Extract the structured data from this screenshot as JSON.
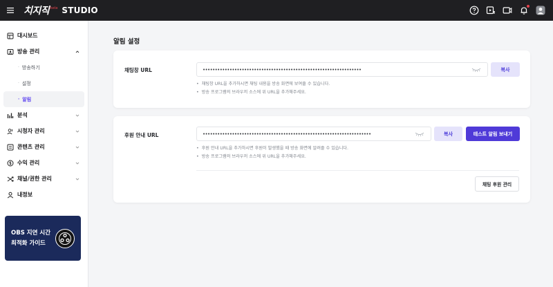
{
  "app": {
    "logo_text": "치지직",
    "beta": "beta",
    "studio": "STUDIO"
  },
  "topbar": {
    "icons": [
      "help-icon",
      "upload-video-icon",
      "camera-icon",
      "notification-bell-icon",
      "user-avatar-icon"
    ],
    "accent_color": "#e5414b"
  },
  "sidebar": {
    "items": [
      {
        "label": "대시보드",
        "icon": "dashboard-icon"
      },
      {
        "label": "방송 관리",
        "icon": "broadcast-icon",
        "expanded": true,
        "children": [
          {
            "label": "방송하기"
          },
          {
            "label": "설정"
          },
          {
            "label": "알림",
            "active": true
          }
        ]
      },
      {
        "label": "분석",
        "icon": "analytics-icon"
      },
      {
        "label": "시청자 관리",
        "icon": "viewers-icon"
      },
      {
        "label": "콘텐츠 관리",
        "icon": "content-icon"
      },
      {
        "label": "수익 관리",
        "icon": "revenue-icon"
      },
      {
        "label": "채널/권한 관리",
        "icon": "channel-permission-icon"
      },
      {
        "label": "내정보",
        "icon": "profile-icon"
      }
    ],
    "banner": {
      "line1": "OBS 지연 시간",
      "line2": "최적화 가이드",
      "icon": "obs-logo-icon"
    }
  },
  "main": {
    "title": "알림 설정",
    "chat": {
      "label": "채팅창 URL",
      "value": "•••••••••••••••••••••••••••••••••••••••••••••••••••••••••••••••••",
      "copy": "복사",
      "help": [
        "채팅창 URL을 추가하시면 채팅 내용을 방송 화면에 보여줄 수 있습니다.",
        "방송 프로그램의 브라우저 소스에 위 URL을 추가해주세요."
      ]
    },
    "donation": {
      "label": "후원 안내 URL",
      "value": "•••••••••••••••••••••••••••••••••••••••••••••••••••••••••••••••••••••",
      "copy": "복사",
      "test": "테스트 알림 보내기",
      "help": [
        "후원 안내 URL을 추가하시면 후원이 발생했을 때 방송 화면에 알려줄 수 있습니다.",
        "방송 프로그램의 브라우저 소스에 위 URL을 추가해주세요."
      ],
      "manage": "채팅 후원 관리"
    }
  },
  "colors": {
    "primary": "#4f3ad8",
    "primary_light": "#e5e3fb",
    "active_text": "#5a3ff0",
    "banner_bg": "#1b2a5b"
  }
}
